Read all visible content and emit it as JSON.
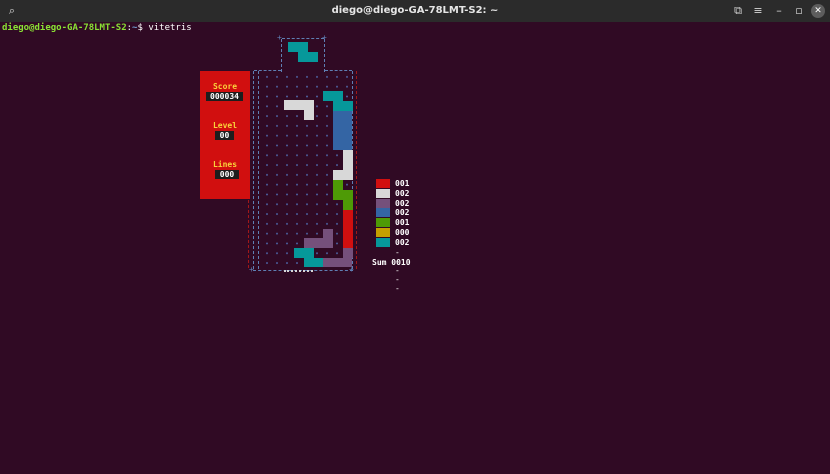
{
  "window": {
    "title": "diego@diego-GA-78LMT-S2: ~",
    "icons": [
      "search-icon",
      "new-tab-icon",
      "menu-icon",
      "minimize-icon",
      "maximize-icon",
      "close-icon"
    ],
    "search_glyph": "⌕",
    "newtab_glyph": "⧉",
    "menu_glyph": "≡",
    "min_glyph": "–",
    "max_glyph": "▫",
    "close_glyph": "✕"
  },
  "terminal": {
    "prompt_user": "diego@diego-GA-78LMT-S2",
    "prompt_sep": ":",
    "prompt_path": "~",
    "prompt_symbol": "$ ",
    "command": "vitetris"
  },
  "game": {
    "score_label": "Score",
    "score_value": "000034",
    "level_label": "Level",
    "level_value": "00",
    "lines_label": "Lines",
    "lines_value": "000",
    "colors": {
      "red": "#d10f0f",
      "white": "#d8d8d8",
      "purple": "#75507b",
      "blue": "#3465a4",
      "green": "#4e9a06",
      "yellow": "#c4a000",
      "cyan": "#06989a"
    },
    "next_piece": {
      "type": "Z",
      "color": "cyan"
    },
    "stats": [
      {
        "color": "red",
        "count": "001"
      },
      {
        "color": "white",
        "count": "002"
      },
      {
        "color": "purple",
        "count": "002"
      },
      {
        "color": "blue",
        "count": "002"
      },
      {
        "color": "green",
        "count": "001"
      },
      {
        "color": "yellow",
        "count": "000"
      },
      {
        "color": "cyan",
        "count": "002"
      }
    ],
    "stats_separator": "-----",
    "stats_sum": "Sum 0010"
  }
}
